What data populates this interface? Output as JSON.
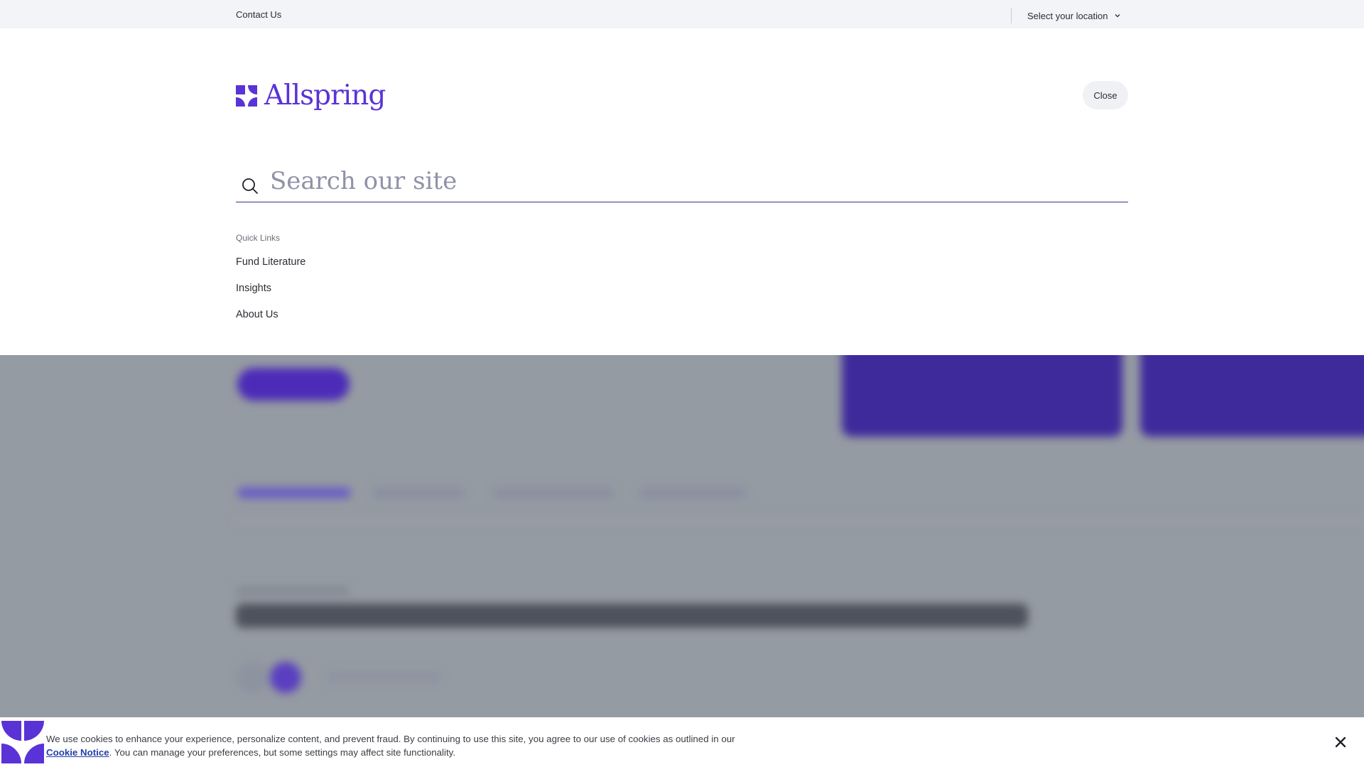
{
  "utility": {
    "contact_label": "Contact Us",
    "location_label": "Select your location",
    "location_icon": "chevron-down-icon"
  },
  "header": {
    "brand": "Allspring",
    "brand_color": "#5a33d6",
    "close_label": "Close"
  },
  "search": {
    "placeholder": "Search our site",
    "value": "",
    "icon": "search-icon"
  },
  "quick_links": {
    "heading": "Quick Links",
    "items": [
      {
        "label": "Fund Literature"
      },
      {
        "label": "Insights"
      },
      {
        "label": "About Us"
      }
    ]
  },
  "cookie_banner": {
    "text_before": "We use cookies to enhance your experience, personalize content, and prevent fraud. By continuing to use this site, you agree to our use of cookies as outlined in our ",
    "link_label": "Cookie Notice",
    "text_after": ". You can manage your preferences, but some settings may affect site functionality.",
    "close_icon": "close-icon"
  },
  "colors": {
    "accent": "#5a33d6",
    "overlay": "#959ba3",
    "link": "#2140a8"
  }
}
